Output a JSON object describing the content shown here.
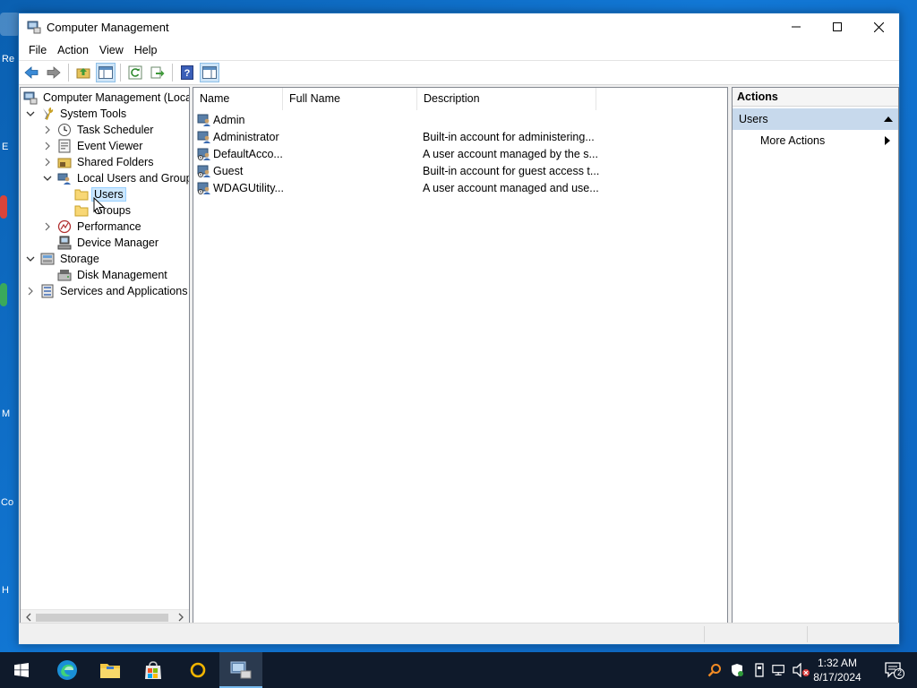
{
  "window": {
    "title": "Computer Management",
    "controls": {
      "minimize": "minimize",
      "maximize": "maximize",
      "close": "close"
    }
  },
  "menu": [
    "File",
    "Action",
    "View",
    "Help"
  ],
  "toolbar": [
    "back-icon",
    "forward-icon",
    "up-folder-icon",
    "show-hide-console-tree-icon",
    "refresh-icon",
    "export-list-icon",
    "help-icon",
    "show-hide-action-pane-icon"
  ],
  "tree": {
    "items": [
      {
        "label": "Computer Management (Local",
        "icon": "computer-management-icon"
      },
      {
        "label": "System Tools",
        "icon": "system-tools-icon"
      },
      {
        "label": "Task Scheduler",
        "icon": "task-scheduler-icon"
      },
      {
        "label": "Event Viewer",
        "icon": "event-viewer-icon"
      },
      {
        "label": "Shared Folders",
        "icon": "shared-folders-icon"
      },
      {
        "label": "Local Users and Groups",
        "icon": "local-users-groups-icon"
      },
      {
        "label": "Users",
        "icon": "folder-icon"
      },
      {
        "label": "Groups",
        "icon": "folder-icon"
      },
      {
        "label": "Performance",
        "icon": "performance-icon"
      },
      {
        "label": "Device Manager",
        "icon": "device-manager-icon"
      },
      {
        "label": "Storage",
        "icon": "storage-icon"
      },
      {
        "label": "Disk Management",
        "icon": "disk-management-icon"
      },
      {
        "label": "Services and Applications",
        "icon": "services-applications-icon"
      }
    ]
  },
  "list": {
    "columns": [
      "Name",
      "Full Name",
      "Description"
    ],
    "rows": [
      {
        "name": "Admin",
        "full_name": "",
        "description": ""
      },
      {
        "name": "Administrator",
        "full_name": "",
        "description": "Built-in account for administering..."
      },
      {
        "name": "DefaultAcco...",
        "full_name": "",
        "description": "A user account managed by the s..."
      },
      {
        "name": "Guest",
        "full_name": "",
        "description": "Built-in account for guest access t..."
      },
      {
        "name": "WDAGUtility...",
        "full_name": "",
        "description": "A user account managed and use..."
      }
    ]
  },
  "actions": {
    "header": "Actions",
    "section": "Users",
    "items": [
      "More Actions"
    ]
  },
  "taskbar": {
    "apps": [
      "start-icon",
      "edge-icon",
      "file-explorer-icon",
      "store-icon",
      "app-circle-icon",
      "computer-management-taskbar-icon"
    ],
    "time": "1:32 AM",
    "date": "8/17/2024",
    "notification_count": "2"
  },
  "desktop": {
    "labels": [
      "Re",
      "E",
      "M",
      "Co",
      "H"
    ]
  },
  "colors": {
    "desktop": "#1278d6",
    "selection": "#cce8ff",
    "actions_section": "#c7d9ec",
    "taskbar": "#0f1a2b"
  }
}
